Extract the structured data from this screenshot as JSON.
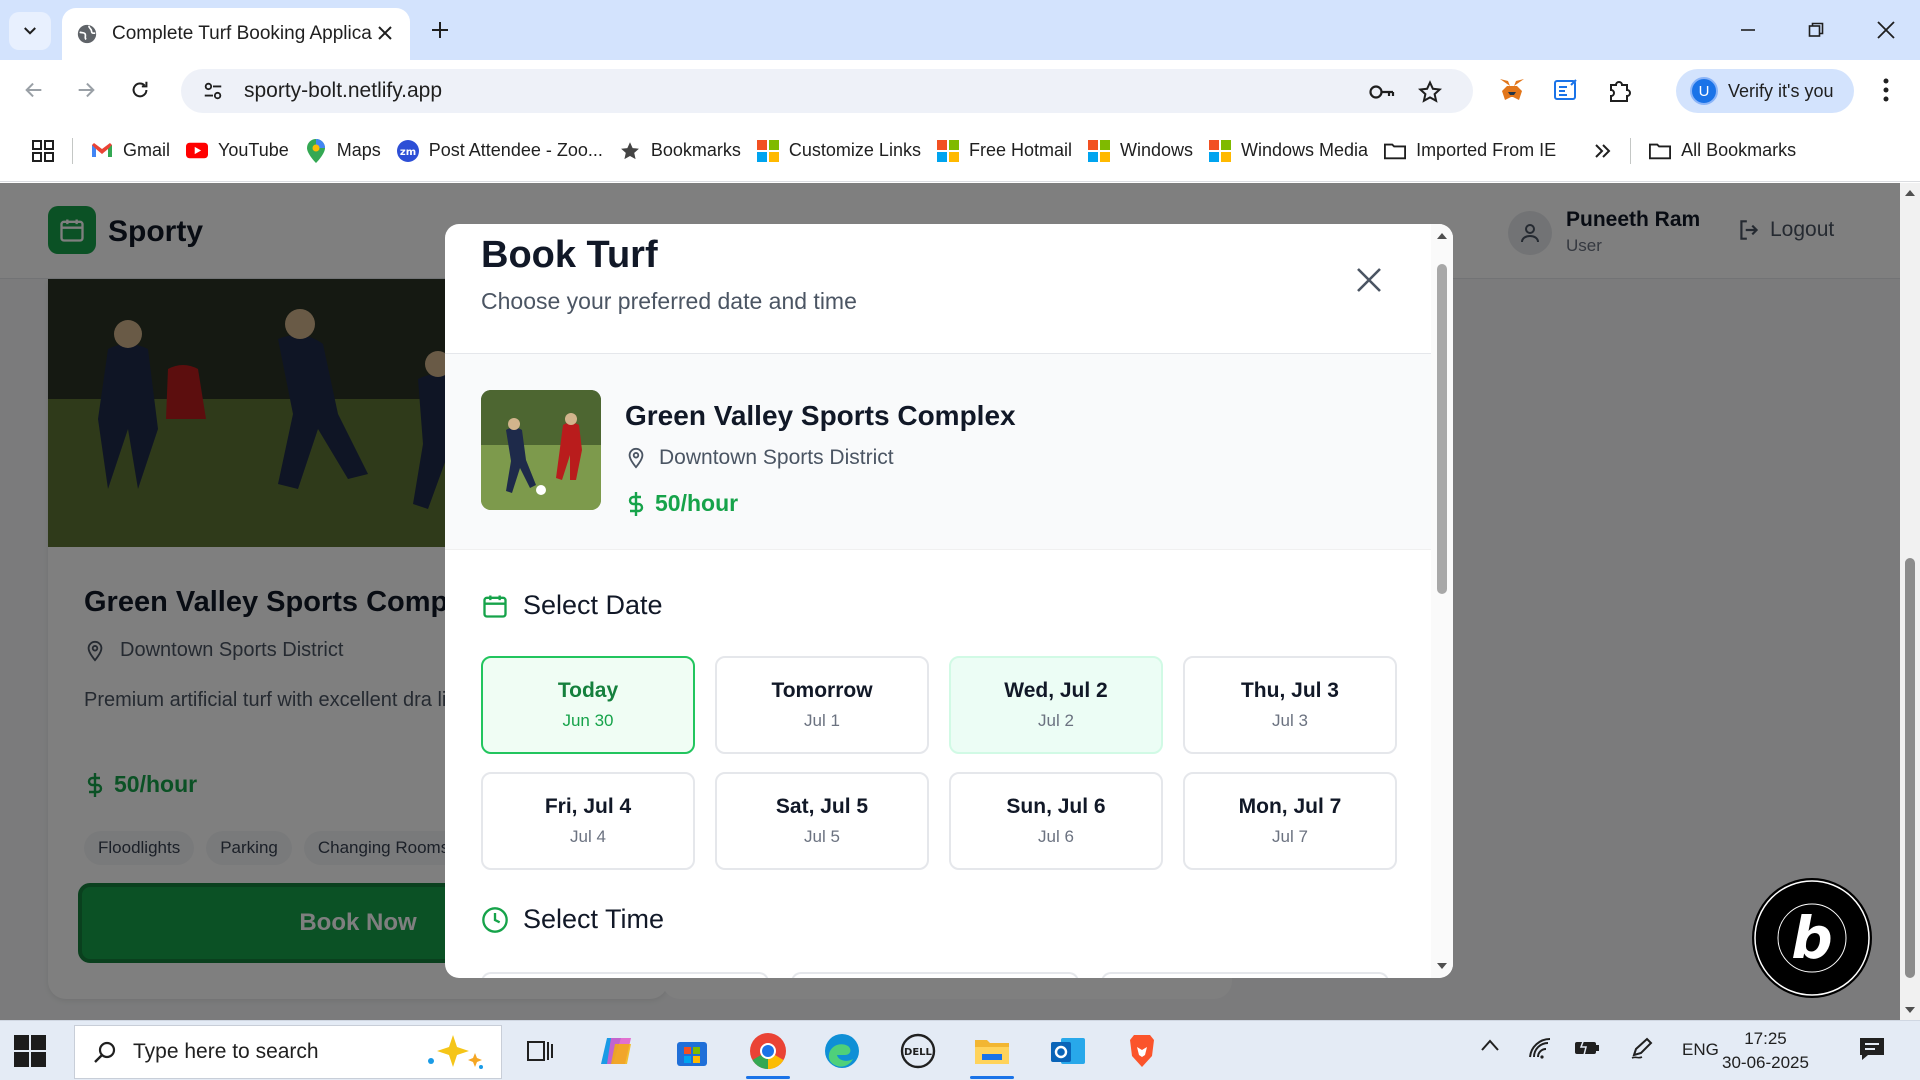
{
  "browser": {
    "tab_title": "Complete Turf Booking Applica",
    "url": "sporty-bolt.netlify.app",
    "profile_button": "Verify it's you",
    "profile_initial": "U",
    "bookmarks": [
      {
        "label": "Gmail",
        "icon": "gmail-icon"
      },
      {
        "label": "YouTube",
        "icon": "youtube-icon"
      },
      {
        "label": "Maps",
        "icon": "maps-icon"
      },
      {
        "label": "Post Attendee - Zoo...",
        "icon": "zoom-icon"
      },
      {
        "label": "Bookmarks",
        "icon": "star-icon"
      },
      {
        "label": "Customize Links",
        "icon": "windows-icon"
      },
      {
        "label": "Free Hotmail",
        "icon": "windows-icon"
      },
      {
        "label": "Windows",
        "icon": "windows-icon"
      },
      {
        "label": "Windows Media",
        "icon": "windows-icon"
      },
      {
        "label": "Imported From IE",
        "icon": "folder-icon"
      }
    ],
    "all_bookmarks": "All Bookmarks"
  },
  "app": {
    "logo": "Sporty",
    "user_name": "Puneeth Ram",
    "user_role": "User",
    "logout": "Logout",
    "brand_color": "#16a34a"
  },
  "card": {
    "title": "Green Valley Sports Comp",
    "location": "Downtown Sports District",
    "description": "Premium artificial turf with excellent dra lighting",
    "price": "50/hour",
    "tags": [
      "Floodlights",
      "Parking",
      "Changing Rooms"
    ],
    "book_now": "Book Now"
  },
  "modal": {
    "title": "Book Turf",
    "subtitle": "Choose your preferred date and time",
    "turf_name": "Green Valley Sports Complex",
    "turf_location": "Downtown Sports District",
    "turf_price": "50/hour",
    "select_date": "Select Date",
    "select_time": "Select Time",
    "dates": [
      {
        "label": "Today",
        "sub": "Jun 30",
        "state": "selected"
      },
      {
        "label": "Tomorrow",
        "sub": "Jul 1",
        "state": "default"
      },
      {
        "label": "Wed, Jul 2",
        "sub": "Jul 2",
        "state": "hover"
      },
      {
        "label": "Thu, Jul 3",
        "sub": "Jul 3",
        "state": "default"
      },
      {
        "label": "Fri, Jul 4",
        "sub": "Jul 4",
        "state": "default"
      },
      {
        "label": "Sat, Jul 5",
        "sub": "Jul 5",
        "state": "default"
      },
      {
        "label": "Sun, Jul 6",
        "sub": "Jul 6",
        "state": "default"
      },
      {
        "label": "Mon, Jul 7",
        "sub": "Jul 7",
        "state": "default"
      }
    ]
  },
  "badge": {
    "text": "b"
  },
  "taskbar": {
    "search_placeholder": "Type here to search",
    "language": "ENG",
    "time": "17:25",
    "date": "30-06-2025"
  }
}
